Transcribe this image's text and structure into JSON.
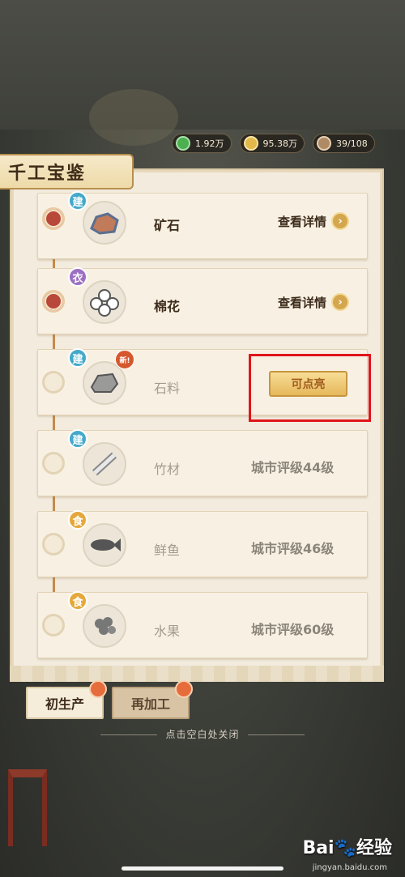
{
  "resources": [
    {
      "icon": "jade-coin-icon",
      "value": "1.92万",
      "color": "#4caf50"
    },
    {
      "icon": "gold-coin-icon",
      "value": "95.38万",
      "color": "#e2b84a"
    },
    {
      "icon": "worker-icon",
      "value": "39/108",
      "color": "#b08a64"
    }
  ],
  "panel": {
    "title": "千工宝鉴"
  },
  "items": [
    {
      "tag": "建",
      "tag_color": "#44a9c9",
      "name": "矿石",
      "icon": "ore-icon",
      "lit": true,
      "action": "查看详情"
    },
    {
      "tag": "衣",
      "tag_color": "#9c6fc3",
      "name": "棉花",
      "icon": "cotton-icon",
      "lit": true,
      "action": "查看详情"
    },
    {
      "tag": "建",
      "tag_color": "#44a9c9",
      "name": "石料",
      "icon": "stone-icon",
      "lit": false,
      "new_badge": "新!",
      "action": "可点亮"
    },
    {
      "tag": "建",
      "tag_color": "#44a9c9",
      "name": "竹材",
      "icon": "bamboo-icon",
      "lit": false,
      "requirement": "城市评级44级"
    },
    {
      "tag": "食",
      "tag_color": "#e5a83b",
      "name": "鲜鱼",
      "icon": "fish-icon",
      "lit": false,
      "requirement": "城市评级46级"
    },
    {
      "tag": "食",
      "tag_color": "#e5a83b",
      "name": "水果",
      "icon": "fruit-icon",
      "lit": false,
      "requirement": "城市评级60级"
    }
  ],
  "tabs": [
    {
      "label": "初生产",
      "active": true
    },
    {
      "label": "再加工",
      "active": false
    }
  ],
  "close_hint": "点击空白处关闭",
  "watermark": {
    "brand": "Bai🐾经验",
    "url": "jingyan.baidu.com"
  }
}
